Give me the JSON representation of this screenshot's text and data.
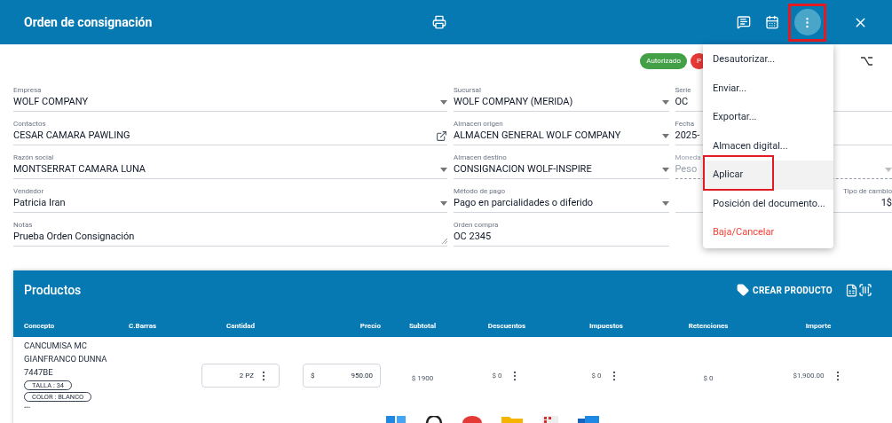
{
  "header": {
    "title": "Orden de consignación",
    "menu_button": {
      "highlighted": true
    }
  },
  "status_chips": [
    {
      "label": "Autorizado",
      "color": "#43a047"
    },
    {
      "label": "P",
      "color": "#e53935"
    }
  ],
  "form": {
    "columns": [
      [
        {
          "label": "Empresa",
          "value": "WOLF COMPANY",
          "kind": "select",
          "disabled": false
        },
        {
          "label": "Contactos",
          "value": "CESAR CAMARA PAWLING",
          "kind": "link",
          "disabled": false
        },
        {
          "label": "Razón social",
          "value": "MONTSERRAT CAMARA LUNA",
          "kind": "select",
          "disabled": false
        },
        {
          "label": "Vendedor",
          "value": "Patricia Iran",
          "kind": "select",
          "disabled": false
        },
        {
          "label": "Notas",
          "value": "Prueba Orden Consignación",
          "kind": "textarea",
          "disabled": false
        }
      ],
      [
        {
          "label": "Sucursal",
          "value": "WOLF COMPANY (MERIDA)",
          "kind": "select",
          "disabled": false
        },
        {
          "label": "Almacen origen",
          "value": "ALMACEN GENERAL WOLF COMPANY",
          "kind": "select",
          "disabled": false
        },
        {
          "label": "Almacen destino",
          "value": "CONSIGNACION WOLF-INSPIRE",
          "kind": "select",
          "disabled": false
        },
        {
          "label": "Método de pago",
          "value": "Pago en parcialidades o diferido",
          "kind": "select",
          "disabled": false
        },
        {
          "label": "Orden compra",
          "value": "OC 2345",
          "kind": "text",
          "disabled": false
        }
      ],
      [
        {
          "label": "Serie",
          "value": "OC",
          "kind": "text",
          "disabled": false
        },
        {
          "label": "Fecha",
          "value": "2025-",
          "kind": "text",
          "disabled": false
        },
        {
          "label": "Moneda",
          "value": "Peso",
          "kind": "select",
          "disabled": true
        },
        {
          "label": "Tipo de cambio",
          "value": "1$",
          "kind": "number",
          "disabled": false
        }
      ]
    ]
  },
  "menu": [
    {
      "label": "Desautorizar...",
      "danger": false,
      "hovered": false,
      "highlighted": false
    },
    {
      "label": "Enviar...",
      "danger": false,
      "hovered": false,
      "highlighted": false
    },
    {
      "label": "Exportar...",
      "danger": false,
      "hovered": false,
      "highlighted": false
    },
    {
      "label": "Almacen digital...",
      "danger": false,
      "hovered": false,
      "highlighted": false
    },
    {
      "label": "Aplicar",
      "danger": false,
      "hovered": true,
      "highlighted": true
    },
    {
      "label": "Posición del documento...",
      "danger": false,
      "hovered": false,
      "highlighted": false
    },
    {
      "label": "Baja/Cancelar",
      "danger": true,
      "hovered": false,
      "highlighted": false
    }
  ],
  "products": {
    "title": "Productos",
    "create_button": "CREAR PRODUCTO",
    "columns": [
      "Concepto",
      "C.Barras",
      "Cantidad",
      "Precio",
      "Subtotal",
      "Descuentos",
      "Impuestos",
      "Retenciones",
      "Importe"
    ],
    "rows": [
      {
        "concept": "CANCUMISA MC GIANFRANCO DUNNA 7447BE",
        "attributes": [
          "TALLA : 34",
          "COLOR : BLANCO"
        ],
        "more": "•••",
        "quantity": "2 PZ",
        "currency": "$",
        "price": "950.00",
        "subtotal": "$ 1900",
        "discounts": "$ 0",
        "taxes": "$ 0",
        "withholdings": "$ 0",
        "amount": "$1,900.00"
      }
    ]
  }
}
